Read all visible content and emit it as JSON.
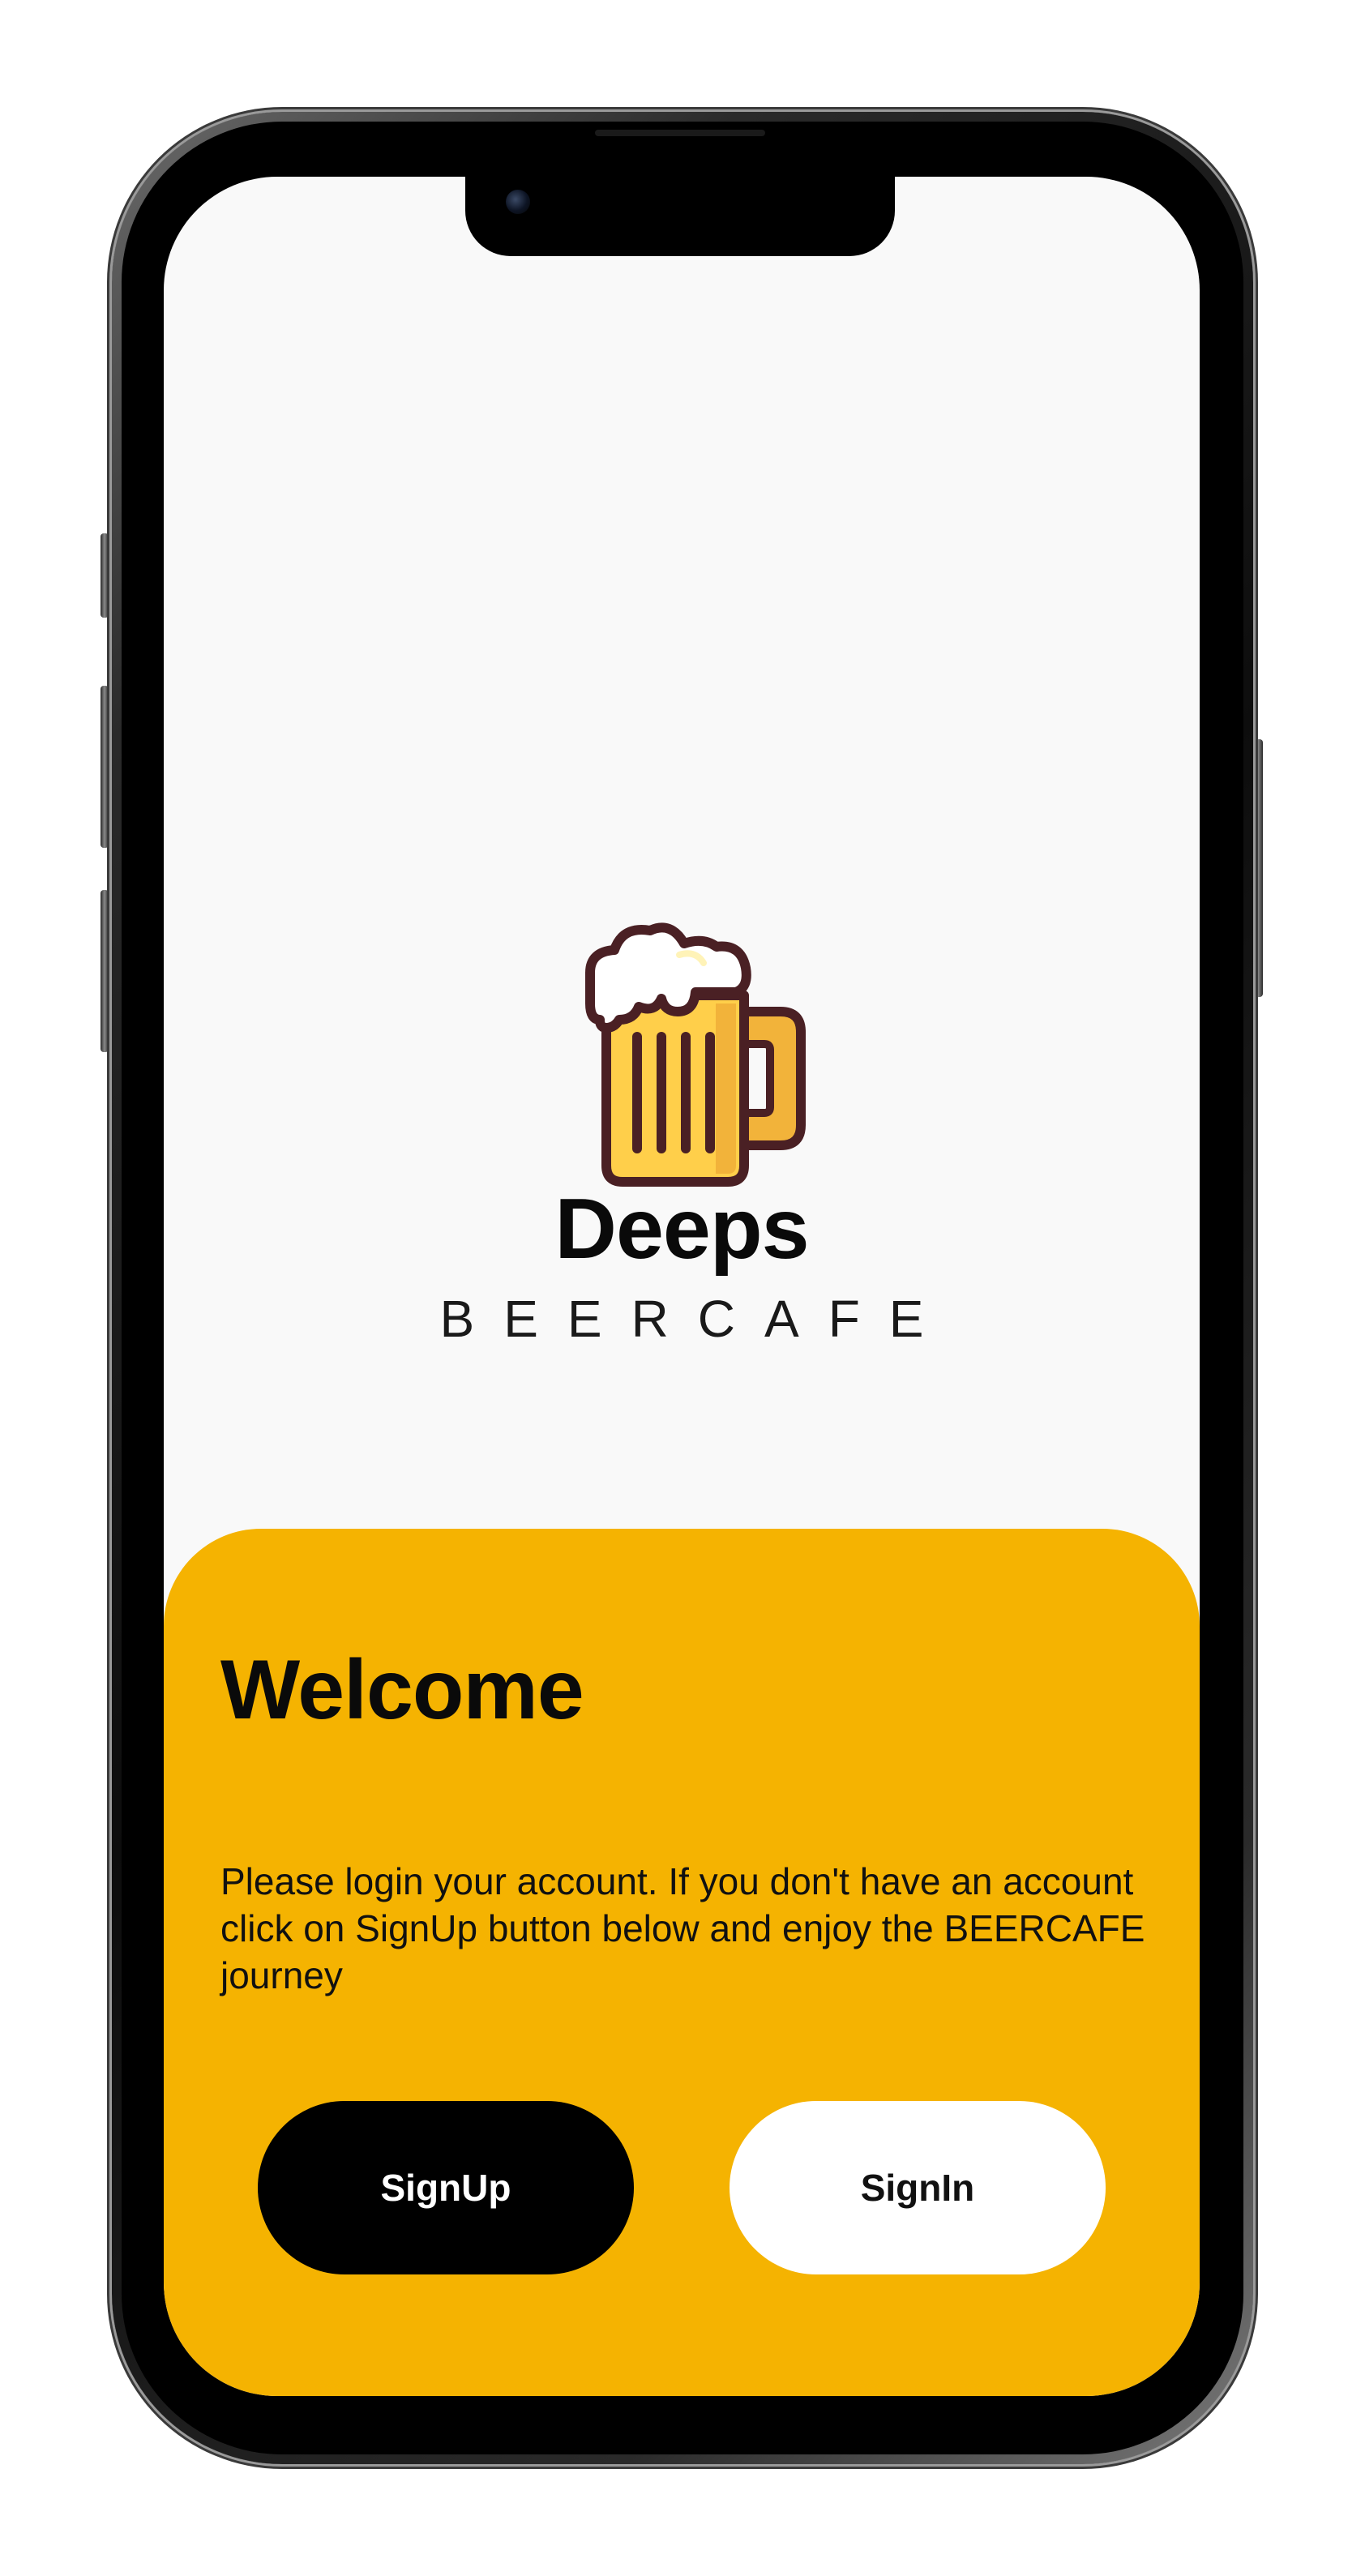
{
  "app": {
    "brand_title": "Deeps",
    "brand_subtitle": "BEERCAFE",
    "logo_icon": "beer-mug-icon"
  },
  "welcome_panel": {
    "heading": "Welcome",
    "description": "Please login your account. If you don't have an account click on SignUp button below and enjoy the BEERCAFE journey",
    "signup_label": "SignUp",
    "signin_label": "SignIn"
  },
  "colors": {
    "accent": "#f5b301",
    "screen_background": "#f9f9f9",
    "signup_button": "#000000",
    "signin_button": "#ffffff",
    "mug_outline": "#4a2024",
    "mug_beer": "#ffcf4a",
    "mug_foam": "#ffffff"
  }
}
